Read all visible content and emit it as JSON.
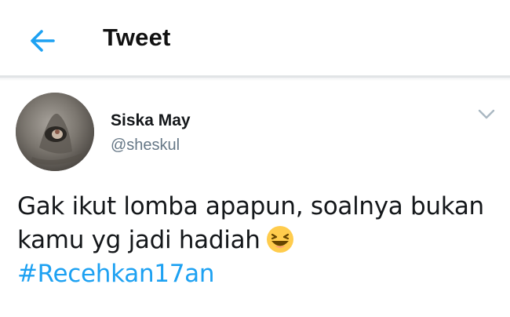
{
  "header": {
    "title": "Tweet",
    "back_icon": "arrow-left-icon",
    "accent": "#1da1f2"
  },
  "tweet": {
    "author": {
      "display_name": "Siska May",
      "handle": "@sheskul"
    },
    "text_line_1": "Gak ikut lomba apapun, soalnya bukan",
    "text_line_2": "kamu yg jadi hadiah",
    "emoji": "laughing-face-emoji",
    "hashtag": "#Recehkan17an",
    "menu_icon": "chevron-down-icon"
  }
}
